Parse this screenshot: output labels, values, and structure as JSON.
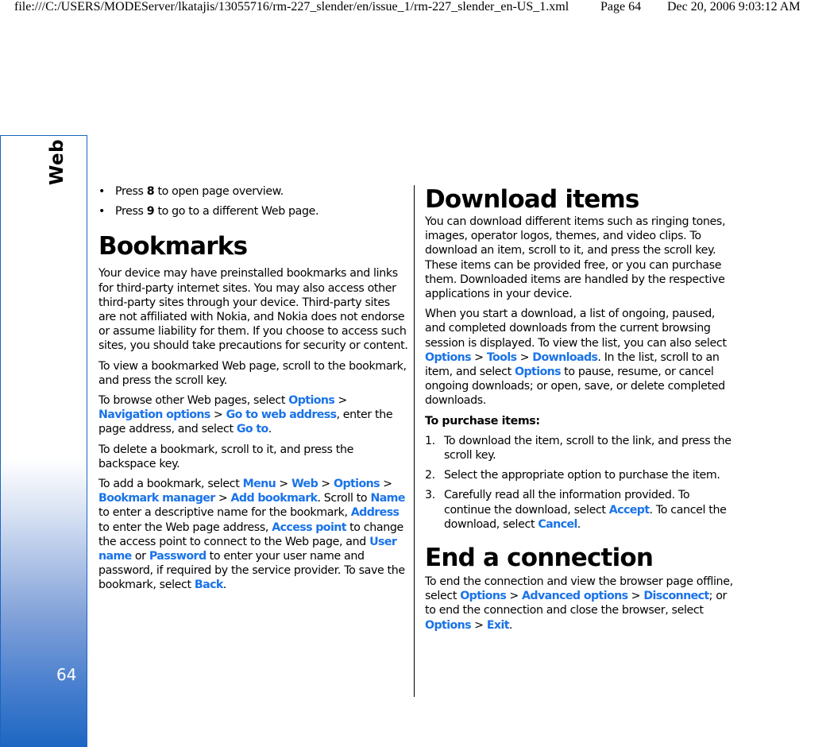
{
  "print_header": {
    "url": "file:///C:/USERS/MODEServer/lkatajis/13055716/rm-227_slender/en/issue_1/rm-227_slender_en-US_1.xml",
    "page": "Page 64",
    "datetime": "Dec 20, 2006 9:03:12 AM"
  },
  "side_tab": {
    "section": "Web",
    "page_number": "64"
  },
  "colors": {
    "link": "#1a73e8",
    "tab_border": "#1a65bf",
    "tab_gradient_bottom": "#1c66c2"
  },
  "left": {
    "bullets": [
      {
        "pre": "Press ",
        "key": "8",
        "post": " to open page overview."
      },
      {
        "pre": "Press ",
        "key": "9",
        "post": " to go to a different Web page."
      }
    ],
    "bookmarks_heading": "Bookmarks",
    "p1": "Your device may have preinstalled bookmarks and links for third-party internet sites. You may also access other third-party sites through your device. Third-party sites are not affiliated with Nokia, and Nokia does not endorse or assume liability for them. If you choose to access such sites, you should take precautions for security or content.",
    "p2": "To view a bookmarked Web page, scroll to the bookmark, and press the scroll key.",
    "p3": {
      "t1": "To browse other Web pages, select ",
      "l1": "Options",
      "t2": " > ",
      "l2": "Navigation options",
      "t3": " > ",
      "l3": "Go to web address",
      "t4": ", enter the page address, and select ",
      "l4": "Go to",
      "t5": "."
    },
    "p4": "To delete a bookmark, scroll to it, and press the backspace key.",
    "p5": {
      "t1": "To add a bookmark, select ",
      "l1": "Menu",
      "t2": " > ",
      "l2": "Web",
      "t3": " > ",
      "l3": "Options",
      "t4": " > ",
      "l4": "Bookmark manager",
      "t5": " > ",
      "l5": "Add bookmark",
      "t6": ". Scroll to ",
      "l6": "Name",
      "t7": " to enter a descriptive name for the bookmark, ",
      "l7": "Address",
      "t8": " to enter the Web page address, ",
      "l8": "Access point",
      "t9": " to change the access point to connect to the Web page, and ",
      "l9": "User name",
      "t10": " or ",
      "l10": "Password",
      "t11": " to enter your user name and password, if required by the service provider. To save the bookmark, select ",
      "l11": "Back",
      "t12": "."
    }
  },
  "right": {
    "download_heading": "Download items",
    "p1": "You can download different items such as ringing tones, images, operator logos, themes, and video clips. To download an item, scroll to it, and press the scroll key. These items can be provided free, or you can purchase them. Downloaded items are handled by the respective applications in your device.",
    "p2": {
      "t1": "When you start a download, a list of ongoing, paused, and completed downloads from the current browsing session is displayed. To view the list, you can also select ",
      "l1": "Options",
      "t2": " > ",
      "l2": "Tools",
      "t3": " > ",
      "l3": "Downloads",
      "t4": ". In the list, scroll to an item, and select ",
      "l4": "Options",
      "t5": " to pause, resume, or cancel ongoing downloads; or open, save, or delete completed downloads."
    },
    "purchase_heading": "To purchase items:",
    "steps": [
      {
        "num": "1.",
        "text": "To download the item, scroll to the link, and press the scroll key."
      },
      {
        "num": "2.",
        "text": "Select the appropriate option to purchase the item."
      },
      {
        "num": "3.",
        "t1": "Carefully read all the information provided. To continue the download, select ",
        "l1": "Accept",
        "t2": ". To cancel the download, select ",
        "l2": "Cancel",
        "t3": "."
      }
    ],
    "end_heading": "End a connection",
    "p3": {
      "t1": "To end the connection and view the browser page offline, select ",
      "l1": "Options",
      "t2": " > ",
      "l2": "Advanced options",
      "t3": " > ",
      "l3": "Disconnect",
      "t4": "; or to end the connection and close the browser, select ",
      "l4": "Options",
      "t5": " > ",
      "l5": "Exit",
      "t6": "."
    }
  }
}
